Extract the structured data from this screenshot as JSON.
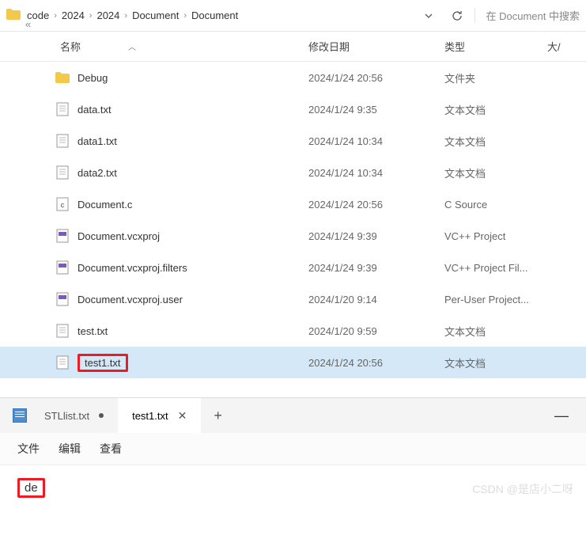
{
  "breadcrumb": {
    "items": [
      "code",
      "2024",
      "2024",
      "Document",
      "Document"
    ],
    "overflow": "«"
  },
  "search": {
    "placeholder": "在 Document 中搜索"
  },
  "columns": {
    "name": "名称",
    "date": "修改日期",
    "type": "类型",
    "size": "大/"
  },
  "files": [
    {
      "name": "Debug",
      "date": "2024/1/24 20:56",
      "type": "文件夹",
      "icon": "folder"
    },
    {
      "name": "data.txt",
      "date": "2024/1/24 9:35",
      "type": "文本文档",
      "icon": "text"
    },
    {
      "name": "data1.txt",
      "date": "2024/1/24 10:34",
      "type": "文本文档",
      "icon": "text"
    },
    {
      "name": "data2.txt",
      "date": "2024/1/24 10:34",
      "type": "文本文档",
      "icon": "text"
    },
    {
      "name": "Document.c",
      "date": "2024/1/24 20:56",
      "type": "C Source",
      "icon": "c"
    },
    {
      "name": "Document.vcxproj",
      "date": "2024/1/24 9:39",
      "type": "VC++ Project",
      "icon": "vcx"
    },
    {
      "name": "Document.vcxproj.filters",
      "date": "2024/1/24 9:39",
      "type": "VC++ Project Fil...",
      "icon": "vcxf"
    },
    {
      "name": "Document.vcxproj.user",
      "date": "2024/1/20 9:14",
      "type": "Per-User Project...",
      "icon": "vcxu"
    },
    {
      "name": "test.txt",
      "date": "2024/1/20 9:59",
      "type": "文本文档",
      "icon": "text"
    },
    {
      "name": "test1.txt",
      "date": "2024/1/24 20:56",
      "type": "文本文档",
      "icon": "text",
      "selected": true,
      "highlight": true
    }
  ],
  "editor": {
    "tabs": [
      {
        "label": "STLlist.txt",
        "modified": true,
        "active": false
      },
      {
        "label": "test1.txt",
        "modified": false,
        "active": true
      }
    ],
    "menu": [
      "文件",
      "编辑",
      "查看"
    ],
    "content": "de",
    "watermark": "CSDN @是店小二呀"
  }
}
